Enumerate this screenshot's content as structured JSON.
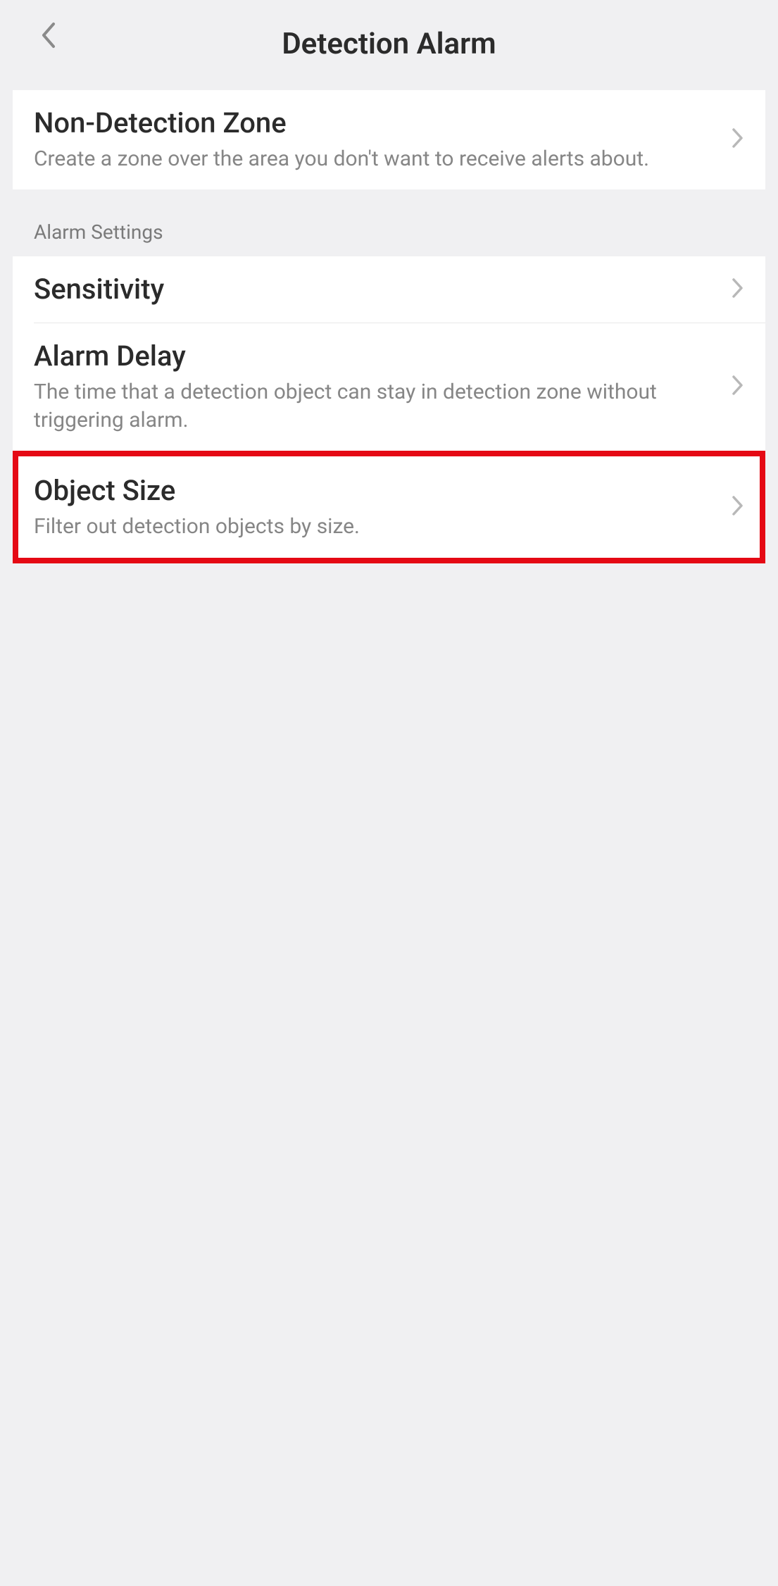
{
  "header": {
    "title": "Detection Alarm"
  },
  "sections": {
    "nonDetectionZone": {
      "title": "Non-Detection Zone",
      "subtitle": "Create a zone over the area you don't want to receive alerts about."
    },
    "alarmSettingsHeader": "Alarm Settings",
    "sensitivity": {
      "title": "Sensitivity"
    },
    "alarmDelay": {
      "title": "Alarm Delay",
      "subtitle": "The time that a detection object can stay in detection zone without triggering alarm."
    },
    "objectSize": {
      "title": "Object Size",
      "subtitle": "Filter out detection objects by size."
    }
  }
}
